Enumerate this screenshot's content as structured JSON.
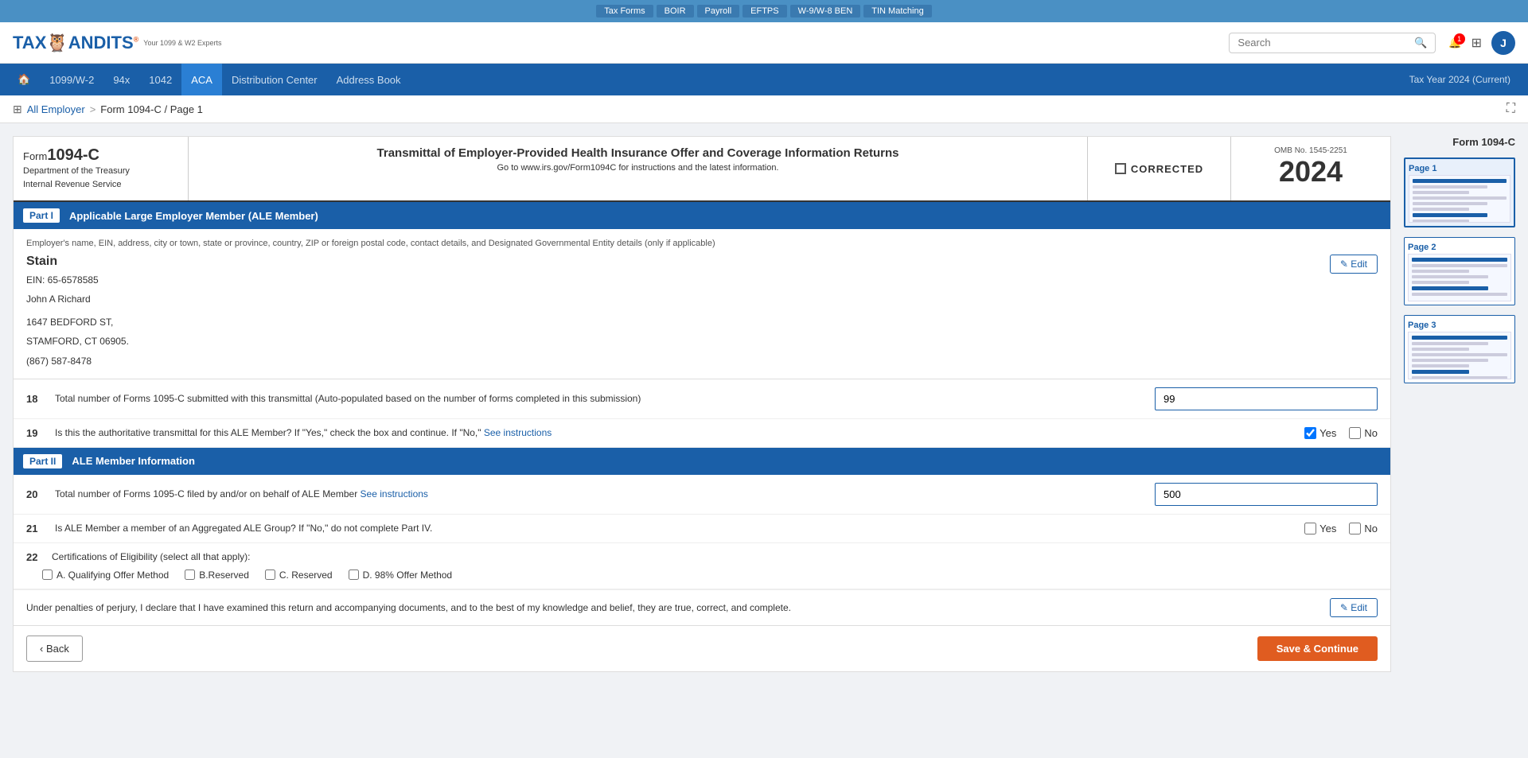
{
  "topbar": {
    "buttons": [
      "Tax Forms",
      "BOIR",
      "Payroll",
      "EFTPS",
      "W-9/W-8 BEN",
      "TIN Matching"
    ]
  },
  "header": {
    "logo": "TAX🦉ANDITS",
    "logo_main": "TAX",
    "logo_emoji": "🦉",
    "logo_end": "ANDITS",
    "logo_sub": "Your 1099 & W2 Experts",
    "search_placeholder": "Search",
    "user_initial": "J"
  },
  "nav": {
    "items": [
      "🏠",
      "1099/W-2",
      "94x",
      "1042",
      "ACA",
      "Distribution Center",
      "Address Book"
    ],
    "active": "ACA",
    "tax_year": "Tax Year 2024 (Current)"
  },
  "breadcrumb": {
    "parent": "All Employer",
    "separator": ">",
    "current": "Form 1094-C / Page 1"
  },
  "sidebar_title": "Form 1094-C",
  "pages": [
    {
      "label": "Page 1",
      "active": true
    },
    {
      "label": "Page 2",
      "active": false
    },
    {
      "label": "Page 3",
      "active": false
    }
  ],
  "form": {
    "form_number": "Form1094-C",
    "form_number_label": "Form",
    "form_number_main": "1094-C",
    "department": "Department of the Treasury",
    "irs": "Internal Revenue Service",
    "title": "Transmittal of Employer-Provided Health Insurance Offer and Coverage Information Returns",
    "subtitle": "Go to www.irs.gov/Form1094C for instructions and the latest information.",
    "corrected_label": "CORRECTED",
    "omb_label": "OMB No. 1545-2251",
    "year": "2024",
    "part1": {
      "label": "Part I",
      "title": "Applicable Large Employer Member (ALE Member)"
    },
    "employer_info_label": "Employer's name, EIN, address, city or town, state or province, country, ZIP or foreign postal code, contact details, and Designated Governmental Entity details (only if applicable)",
    "employer": {
      "name": "Stain",
      "ein": "EIN: 65-6578585",
      "contact": "John A Richard",
      "address1": "1647 BEDFORD ST,",
      "address2": "STAMFORD, CT 06905.",
      "phone": "(867) 587-8478"
    },
    "edit_label": "✎ Edit",
    "field18": {
      "number": "18",
      "label": "Total number of Forms 1095-C submitted with this transmittal  (Auto-populated based on the number of forms completed in this submission)",
      "value": "99"
    },
    "field19": {
      "number": "19",
      "label": "Is this the authoritative transmittal for this ALE Member? If \"Yes,\" check the box and continue. If \"No,\"",
      "link": "See instructions",
      "yes_checked": true,
      "no_checked": false,
      "yes_label": "Yes",
      "no_label": "No"
    },
    "part2": {
      "label": "Part II",
      "title": "ALE Member Information"
    },
    "field20": {
      "number": "20",
      "label": "Total number of Forms 1095-C filed by and/or on behalf of ALE Member",
      "link": "See instructions",
      "value": "500"
    },
    "field21": {
      "number": "21",
      "label": "Is ALE Member a member of an Aggregated ALE Group? If \"No,\" do not complete Part IV.",
      "yes_checked": false,
      "no_checked": false,
      "yes_label": "Yes",
      "no_label": "No"
    },
    "field22": {
      "number": "22",
      "label": "Certifications of Eligibility (select all that apply):",
      "options": [
        {
          "id": "A",
          "label": "A. Qualifying Offer Method",
          "checked": false
        },
        {
          "id": "B",
          "label": "B.Reserved",
          "checked": false
        },
        {
          "id": "C",
          "label": "C. Reserved",
          "checked": false
        },
        {
          "id": "D",
          "label": "D. 98% Offer Method",
          "checked": false
        }
      ]
    },
    "declaration": "Under penalties of perjury, I declare that I have examined this return and accompanying documents, and to the best of my knowledge and belief, they are true, correct, and complete.",
    "edit_declaration_label": "✎ Edit"
  },
  "buttons": {
    "back": "‹ Back",
    "save": "Save & Continue"
  }
}
